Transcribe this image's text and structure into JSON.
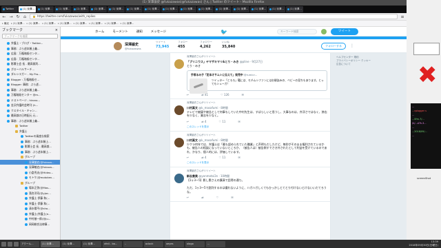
{
  "window": {
    "title": "(1) 深澤諭史 @fukazawas(@fukazawas) さん | Twitter のツイート - Mozilla Firefox"
  },
  "tabs": [
    "Twitter",
    "(1) 深澤...",
    "(1) 深澤...",
    "(1) 深澤...",
    "(1) 深澤...",
    "(1) 深澤...",
    "(1) 深澤...",
    "(1) 深澤...",
    "(1) 深澤...",
    "(1) 深澤...",
    "(1) 深澤...",
    "(1) 深澤...",
    "(1) 深澤...",
    "(1) 深澤...",
    "(1) 深澤...",
    "(1) 深澤...",
    "(1) 深澤..."
  ],
  "navbar": {
    "url": "https://twitter.com/fukazawas/with_replies"
  },
  "bookmarks_bar": [
    "最近",
    "(1) 深澤...",
    "(1) 深澤...",
    "(1) 深澤...",
    "(1) 深澤...",
    "(1) 深澤...",
    "(1) 深澤...",
    "(1) 深澤...",
    "(1) 深澤..."
  ],
  "sidebar": {
    "title": "ブックマーク",
    "close": "×",
    "search_placeholder": "ブックマークを検索",
    "items": [
      {
        "label": "弁護士・ブログ・Twitter...",
        "icon": "page",
        "indent": 10,
        "selected": false
      },
      {
        "label": "事務：ぶら述本勝上義...",
        "icon": "page",
        "indent": 10,
        "selected": false
      },
      {
        "label": "広島：万権暗殺センタ...",
        "icon": "page",
        "indent": 10,
        "selected": false
      },
      {
        "label": "広島：万権暗殺センタ...",
        "icon": "page",
        "indent": 10,
        "selected": false
      },
      {
        "label": "影響士会 長 - 最高裁判...",
        "icon": "page",
        "indent": 10,
        "selected": false
      },
      {
        "label": "グローバルサーチ…",
        "icon": "page",
        "indent": 10,
        "selected": false
      },
      {
        "label": "ダルシエガー - My Pro...",
        "icon": "page",
        "indent": 10,
        "selected": false
      },
      {
        "label": "Blogger : 万権暗殺セ...",
        "icon": "page",
        "indent": 10,
        "selected": false
      },
      {
        "label": "Blogger: 事務：ぶら述...",
        "icon": "page",
        "indent": 10,
        "selected": false
      },
      {
        "label": "事務：ぶら述本勝上義...",
        "icon": "page",
        "indent": 10,
        "selected": false
      },
      {
        "label": "万権暗殺センター @m...",
        "icon": "page",
        "indent": 10,
        "selected": false
      },
      {
        "label": "テストページ - hirono...",
        "icon": "page",
        "indent": 10,
        "selected": false
      },
      {
        "label": "金沢弁護的会時刊 (h...",
        "icon": "page",
        "indent": 10,
        "selected": false
      },
      {
        "label": "クスタイル・キャン...",
        "icon": "page",
        "indent": 10,
        "selected": false
      },
      {
        "label": "最高裁の日時配元 元...",
        "icon": "page",
        "indent": 10,
        "selected": false
      },
      {
        "label": "事務：ぶら述本勝上義...",
        "icon": "page",
        "indent": 10,
        "selected": false
      },
      {
        "label": "Twitter",
        "icon": "folder",
        "indent": 22,
        "selected": false
      },
      {
        "label": "弁護士",
        "icon": "folder",
        "indent": 22,
        "selected": false
      },
      {
        "label": "Twitterの風度な検索",
        "icon": "page",
        "indent": 30,
        "selected": false
      },
      {
        "label": "事務：ぶら述本勝上...",
        "icon": "page",
        "indent": 30,
        "selected": false
      },
      {
        "label": "影響士会 長 - 最高裁...",
        "icon": "page",
        "indent": 30,
        "selected": false
      },
      {
        "label": "事務：ぶら述本勝上...",
        "icon": "page",
        "indent": 30,
        "selected": false
      },
      {
        "label": "グループ",
        "icon": "folder",
        "indent": 30,
        "selected": false
      },
      {
        "label": "深澤諭史(@fukaza...",
        "icon": "page",
        "indent": 36,
        "selected": true
      },
      {
        "label": "深澤敏史(@fukaza...",
        "icon": "page",
        "indent": 36,
        "selected": false
      },
      {
        "label": "小倉秀夫(@Hideo...",
        "icon": "page",
        "indent": 36,
        "selected": false
      },
      {
        "label": "モトケ(@motoken...",
        "icon": "page",
        "indent": 36,
        "selected": false
      },
      {
        "label": "グループ",
        "icon": "folder",
        "indent": 30,
        "selected": false
      },
      {
        "label": "場本正弥(@Mas...",
        "icon": "page",
        "indent": 36,
        "selected": false
      },
      {
        "label": "落合洋司(@yjoc...",
        "icon": "page",
        "indent": 36,
        "selected": false
      },
      {
        "label": "弁護士 伊藤 和(...",
        "icon": "page",
        "indent": 36,
        "selected": false
      },
      {
        "label": "弁護士 伊藤 和(...",
        "icon": "page",
        "indent": 36,
        "selected": false
      },
      {
        "label": "清水陽平(@sho...",
        "icon": "page",
        "indent": 36,
        "selected": false
      },
      {
        "label": "弁護士(弁護士(e...",
        "icon": "page",
        "indent": 36,
        "selected": false
      },
      {
        "label": "中村基一郎(@ju...",
        "icon": "page",
        "indent": 36,
        "selected": false
      },
      {
        "label": "岡岡総合法律事...",
        "icon": "page",
        "indent": 36,
        "selected": false
      }
    ]
  },
  "twitter": {
    "nav": [
      "ホーム",
      "モーメント",
      "通知",
      "メッセージ"
    ],
    "search_placeholder": "キーワード検索",
    "tweet_button": "ツイート",
    "profile": {
      "name": "深澤諭史",
      "handle": "@fukazawas",
      "follow_label": "フォローする",
      "stats": [
        {
          "label": "ツイート",
          "value": "73,945"
        },
        {
          "label": "フォロー",
          "value": "455"
        },
        {
          "label": "フォロワー",
          "value": "4,262"
        },
        {
          "label": "いいね",
          "value": "35,840"
        }
      ]
    },
    "side_note": "ヘルプセンター 規約\nプライバシーポリシー クッキー\n広告について",
    "tweets": [
      {
        "rt_note": "深澤諭史さんがリツイート",
        "name": "「プリニウス」ヤマザキマリ&とり・みき",
        "handle": "@pline · 9月27日",
        "text": "とり・みき",
        "avatar_color": "#c9a04a",
        "quote": {
          "name": "手塚るみ子「定本オサムシに伝えて」発売中",
          "handle": "@rumicr...",
          "text": "ツイッター「とろろ」騒には、モチムシファンにはお馴染みの、ベビーの見ちもあります。とってもシューガ！"
        },
        "actions": [
          "↩",
          "⇄ 41",
          "♡ 126",
          "✉"
        ]
      },
      {
        "rt_note": "深澤諭史さんがリツイート",
        "name": "川村真文",
        "handle": "@k_masafumi · 8時間",
        "text": "テレビで被疑や被告として何事もしていた中村先生は、すばらしいと思うし、大事なのは、弁浮さではなく、誇志を少なく、業志を少なく。",
        "avatar_color": "#6b4a2b",
        "thread": "このスレッドを表示",
        "actions": [
          "↩",
          "⇄ 4",
          "♡ 11",
          "✉"
        ]
      },
      {
        "rt_note": "深澤諭史さんがリツイート",
        "name": "川村真文",
        "handle": "@k_masafumi · 8時間",
        "text": "少クラ何年では、弁護士は「最も認められていた職業」と声明もだしたけど、毎秒がそのまま権利されているかも、被告人の相談になっていないところか、（被告人は）被告側すでさき外されたとして利益を受けているのであれ、かなり、個人的には、評価しています。",
        "avatar_color": "#6b4a2b",
        "thread": "このスレッドを表示",
        "actions": [
          "↩",
          "⇄ 4",
          "♡ 11",
          "✉"
        ]
      },
      {
        "rt_note": "深澤諭史さんがリツイート",
        "name": "新谷貴美",
        "handle": "@yonmotoi3n · 10時間",
        "text": "【1ヶ3〜5】影し素さえの講演で話得の通り。\n\nただ、1ヶ3〜5で説判するのは優れないように、ハガハガしくてもひっかしとてとり付けないとけないいだてろうな。",
        "avatar_color": "#3a6a8a",
        "actions": [
          "↩",
          "⇄",
          "♡",
          "✉"
        ]
      }
    ]
  },
  "taskbar": {
    "tasks": [
      "アクール...",
      "(1) 深澤...",
      "(1) 深澤...",
      "(1) 深澤...",
      "xfe4 - ba...",
      "..",
      "oclock",
      "xeyes",
      "xlogo",
      "..."
    ],
    "time": "13:39",
    "date": "2018年09月30日(日曜日)"
  },
  "right_panel": {
    "terminal_lines": [
      "...",
      "...cplogger s",
      "...",
      "...0fm-7/...",
      "/h/...d7k-3...",
      "...",
      "...2018/09/...",
      "..."
    ],
    "screenshot_label": "screenShot"
  }
}
